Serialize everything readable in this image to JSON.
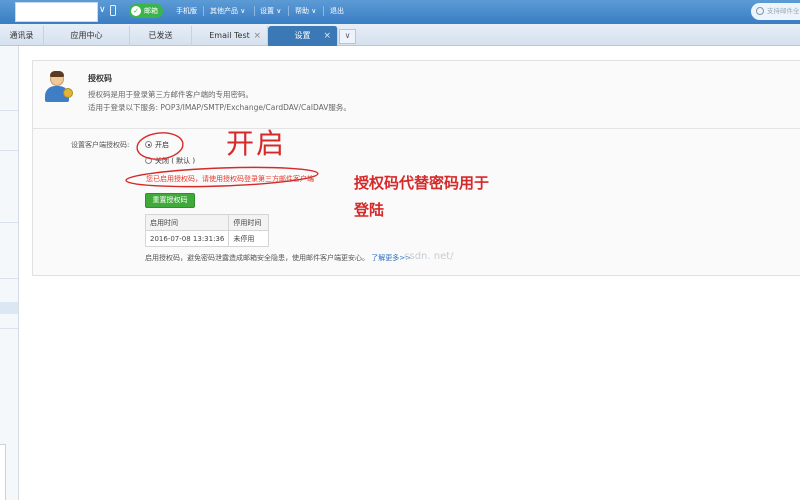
{
  "topbar": {
    "vip_label": "邮箱",
    "nav": [
      "手机版",
      "其他产品 ∨",
      "设置 ∨",
      "帮助 ∨",
      "退出"
    ],
    "search_placeholder": "支持邮件全"
  },
  "tabs": [
    {
      "label": "通讯录"
    },
    {
      "label": "应用中心"
    },
    {
      "label": "已发送"
    },
    {
      "label": "Email Test"
    },
    {
      "label": "设置"
    }
  ],
  "panel": {
    "title": "授权码",
    "desc_line1": "授权码是用于登录第三方邮件客户端的专用密码。",
    "desc_line2": "适用于登录以下服务: POP3/IMAP/SMTP/Exchange/CardDAV/CalDAV服务。",
    "setting_label": "设置客户端授权码:",
    "option_on": "开启",
    "option_off": "关闭 ( 默认 )",
    "notice": "您已启用授权码，请使用授权码登录第三方邮件客户端",
    "regen_button": "重置授权码",
    "table": {
      "headers": [
        "启用时间",
        "停用时间"
      ],
      "row": [
        "2016-07-08 13:31:36",
        "未停用"
      ]
    },
    "footnote": "启用授权码，避免密码泄露造成邮箱安全隐患，使用邮件客户端更安心。",
    "learn_more": "了解更多>>",
    "watermark": "csdn. net/"
  },
  "annotations": {
    "handwritten": "开启",
    "line1": "授权码代替密码用于",
    "line2": "登陆"
  },
  "colors": {
    "topbar": "#3a7dc4",
    "active_tab": "#3b78b6",
    "annotation_red": "#d42a2a",
    "button_green": "#3faa3a"
  }
}
